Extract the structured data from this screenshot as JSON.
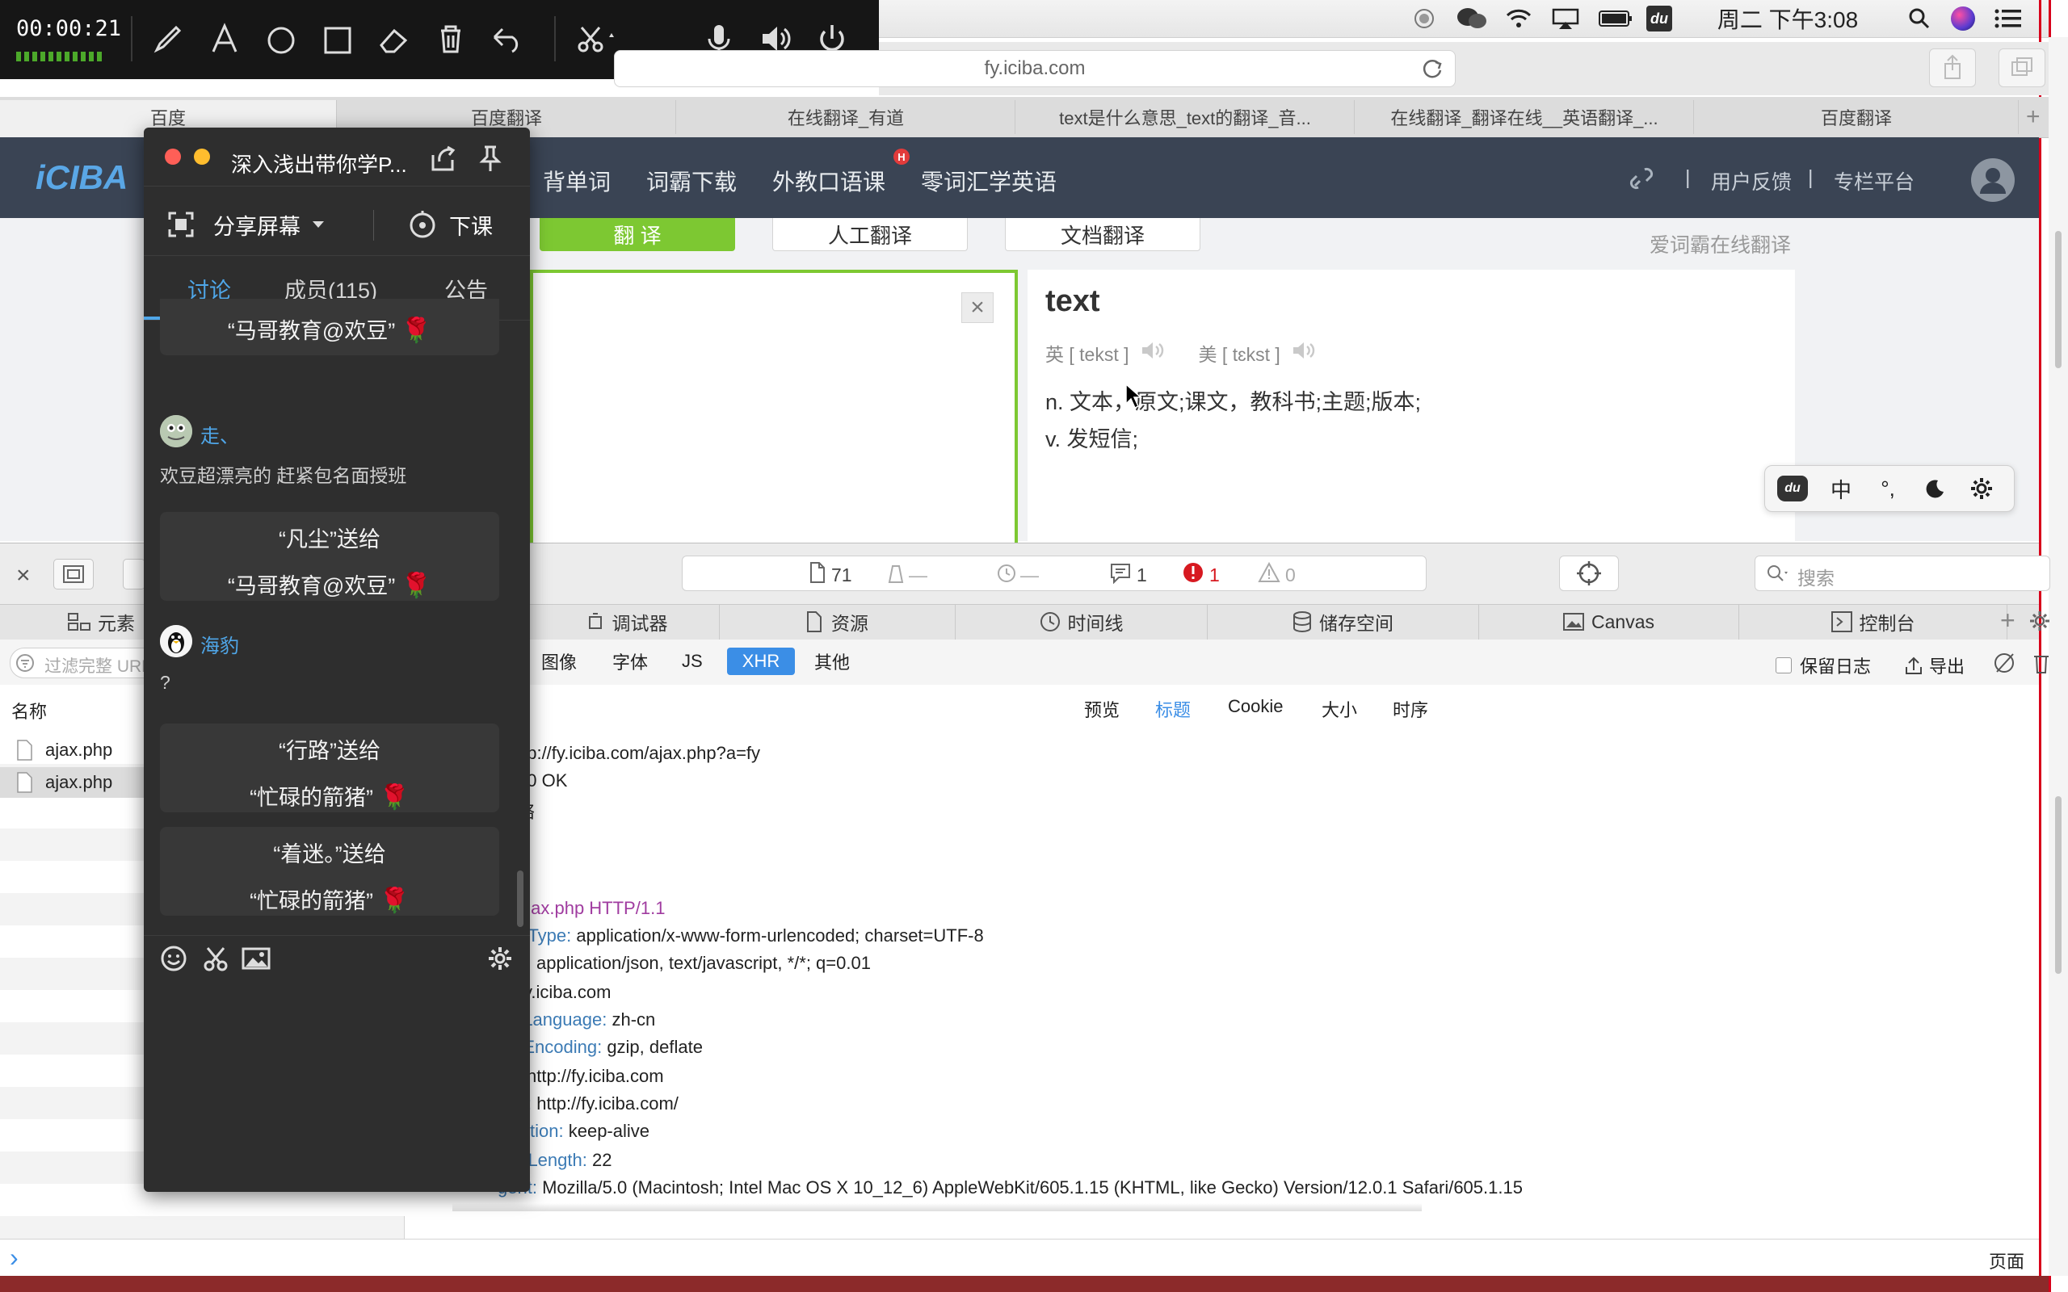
{
  "recorder": {
    "elapsed": "00:00:21"
  },
  "menubar": {
    "clock": "周二 下午3:08"
  },
  "browser": {
    "url": "fy.iciba.com",
    "tabs": [
      "百度",
      "百度翻译",
      "在线翻译_有道",
      "text是什么意思_text的翻译_音...",
      "在线翻译_翻译在线__英语翻译_...",
      "百度翻译"
    ]
  },
  "site": {
    "logo": "iCIBA",
    "nav": [
      "背单词",
      "词霸下载",
      "外教口语课",
      "零词汇学英语"
    ],
    "nav_badge": "H",
    "user_feedback": "用户反馈",
    "column_platform": "专栏平台",
    "separator": "|",
    "modes": [
      "翻 译",
      "人工翻译",
      "文档翻译"
    ],
    "slogan": "爱词霸在线翻译",
    "clear_symbol": "×",
    "result": {
      "word": "text",
      "uk_label": "英 [ tekst ]",
      "us_label": "美 [ tɛkst ]",
      "def_noun": "n. 文本，原文;课文，教科书;主题;版本;",
      "def_verb": "v. 发短信;"
    },
    "ime": [
      "中",
      "°,"
    ]
  },
  "devtools": {
    "resources_count": "71",
    "dash1": "—",
    "dash2": "—",
    "logs_count": "1",
    "errors_count": "1",
    "warnings_count": "0",
    "search_placeholder": "搜索",
    "tabs": [
      "元素",
      "调试器",
      "资源",
      "时间线",
      "储存空间",
      "Canvas",
      "控制台"
    ],
    "filter_placeholder": "过滤完整 URL",
    "types": [
      "图像",
      "字体",
      "JS",
      "XHR",
      "其他"
    ],
    "preserve_log": "保留日志",
    "export": "导出",
    "name_col": "名称",
    "files": [
      "ajax.php",
      "ajax.php"
    ],
    "subtabs": [
      "预览",
      "标题",
      "Cookie",
      "大小",
      "时序"
    ],
    "summary": [
      "ttp://fy.iciba.com/ajax.php?a=fy",
      "00 OK",
      "络"
    ],
    "request_line": "ajax.php HTTP/1.1",
    "headers": [
      {
        "k": "t-Type:",
        "v": "application/x-www-form-urlencoded; charset=UTF-8"
      },
      {
        "k": "",
        "v": "application/json, text/javascript, */*; q=0.01"
      },
      {
        "k": "",
        "v": "y.iciba.com"
      },
      {
        "k": "-Language:",
        "v": "zh-cn"
      },
      {
        "k": "-Encoding:",
        "v": "gzip, deflate"
      },
      {
        "k": "",
        "v": "http://fy.iciba.com"
      },
      {
        "k": ":",
        "v": "http://fy.iciba.com/"
      },
      {
        "k": "tion:",
        "v": "keep-alive"
      },
      {
        "k": "t-Length:",
        "v": "22"
      },
      {
        "k": "gent:",
        "v": "Mozilla/5.0 (Macintosh; Intel Mac OS X 10_12_6) AppleWebKit/605.1.15 (KHTML, like Gecko) Version/12.0.1 Safari/605.1.15"
      }
    ],
    "console_prompt": "›",
    "page_label": "页面"
  },
  "chat": {
    "title": "深入浅出带你学P...",
    "share_screen": "分享屏幕",
    "end_class": "下课",
    "tabs": [
      "讨论",
      "成员(115)",
      "公告"
    ],
    "partial_top": "“马哥教育@欢豆”",
    "user1": {
      "name": "走、",
      "msg": "欢豆超漂亮的 赶紧包名面授班"
    },
    "gift2": {
      "from": "“凡尘”送给",
      "to": "“马哥教育@欢豆”"
    },
    "user2": {
      "name": "海豹",
      "msg": "?"
    },
    "gift3": {
      "from": "“行路”送给",
      "to": "“忙碌的箭猪”"
    },
    "gift4": {
      "from": "“着迷。”送给",
      "to": "“忙碌的箭猪”"
    }
  },
  "colors": {
    "site_header": "#3a4454",
    "accent_green": "#7dc832",
    "chat_bg": "#2e2e2e",
    "xhr_blue": "#3b8ee6",
    "error_red": "#d71920"
  }
}
